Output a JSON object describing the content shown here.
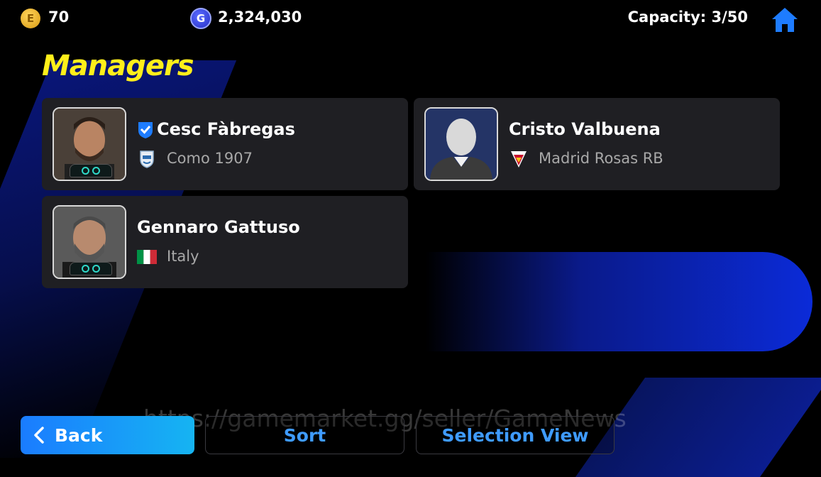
{
  "header": {
    "ecoin_value": "70",
    "gp_value": "2,324,030",
    "capacity": "Capacity: 3/50",
    "ecoin_glyph": "E",
    "gp_glyph": "G"
  },
  "page_title": "Managers",
  "managers": [
    {
      "name": "Cesc Fàbregas",
      "team": "Como 1907",
      "verified": true,
      "icon": "club-crest-icon"
    },
    {
      "name": "Cristo Valbuena",
      "team": "Madrid Rosas RB",
      "verified": false,
      "icon": "club-crest-icon"
    },
    {
      "name": "Gennaro Gattuso",
      "team": "Italy",
      "verified": false,
      "icon": "italy-flag-icon"
    }
  ],
  "buttons": {
    "back": "Back",
    "sort": "Sort",
    "selection_view": "Selection View"
  },
  "watermark": "https://gamemarket.gg/seller/GameNews",
  "colors": {
    "title": "#ffef1a",
    "accent": "#3f9bff",
    "card": "#1f1f23"
  }
}
